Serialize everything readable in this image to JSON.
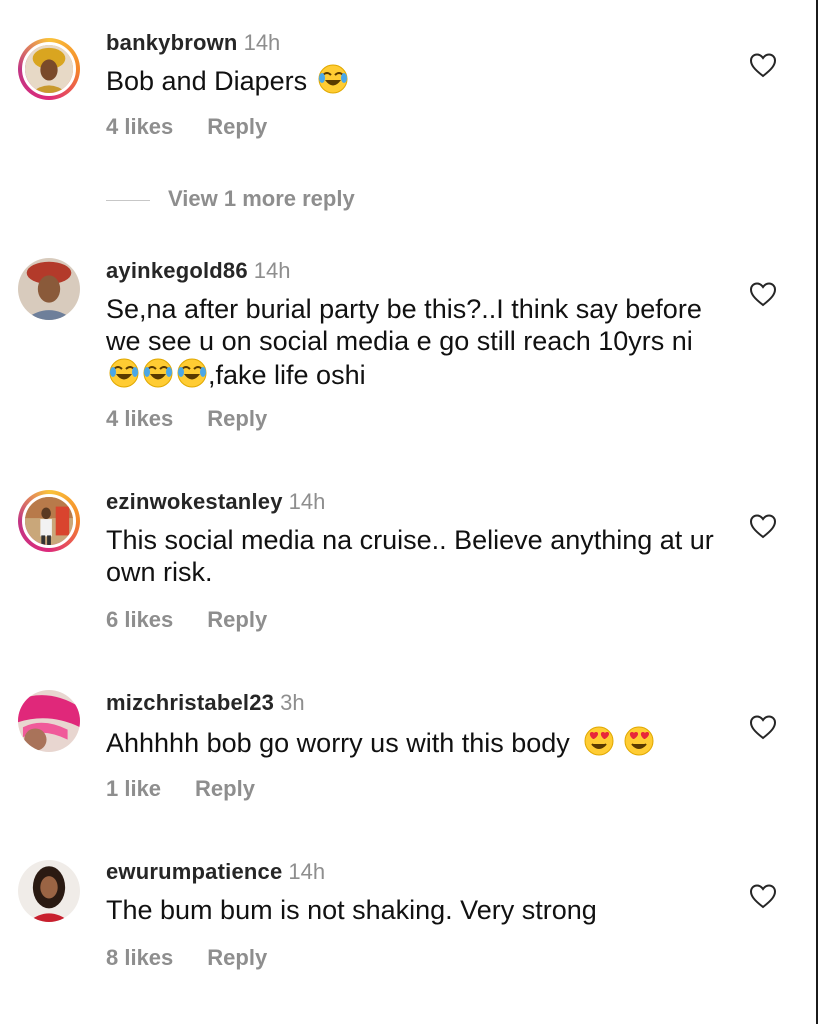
{
  "comments": [
    {
      "username": "bankybrown",
      "time": "14h",
      "text": "Bob and Diapers",
      "likes": "4 likes",
      "reply": "Reply",
      "avatar_ring": true,
      "emojis": [
        "face-with-tears-of-joy"
      ]
    },
    {
      "username": "ayinkegold86",
      "time": "14h",
      "text_before": "Se,na after burial party be this?..I think say before we see u on social media e go still reach 10yrs ni",
      "text_after": ",fake life oshi",
      "likes": "4 likes",
      "reply": "Reply",
      "avatar_ring": false,
      "emojis": [
        "face-with-tears-of-joy",
        "face-with-tears-of-joy",
        "face-with-tears-of-joy"
      ]
    },
    {
      "username": "ezinwokestanley",
      "time": "14h",
      "text": "This social media na cruise.. Believe anything at ur own risk.",
      "likes": "6 likes",
      "reply": "Reply",
      "avatar_ring": true
    },
    {
      "username": "mizchristabel23",
      "time": "3h",
      "text": "Ahhhhh bob go worry us with this body",
      "likes": "1 like",
      "reply": "Reply",
      "avatar_ring": false,
      "emojis": [
        "smiling-face-with-heart-eyes",
        "smiling-face-with-heart-eyes"
      ]
    },
    {
      "username": "ewurumpatience",
      "time": "14h",
      "text": "The bum bum is not shaking. Very strong",
      "likes": "8 likes",
      "reply": "Reply",
      "avatar_ring": false
    }
  ],
  "view_more_replies": "View 1 more reply",
  "icons": {
    "like": "heart-outline-icon"
  },
  "colors": {
    "text": "#262626",
    "secondary": "#8e8e8e",
    "story_ring": [
      "#f9c33a",
      "#f58529",
      "#dd2a7b",
      "#c13584"
    ]
  }
}
